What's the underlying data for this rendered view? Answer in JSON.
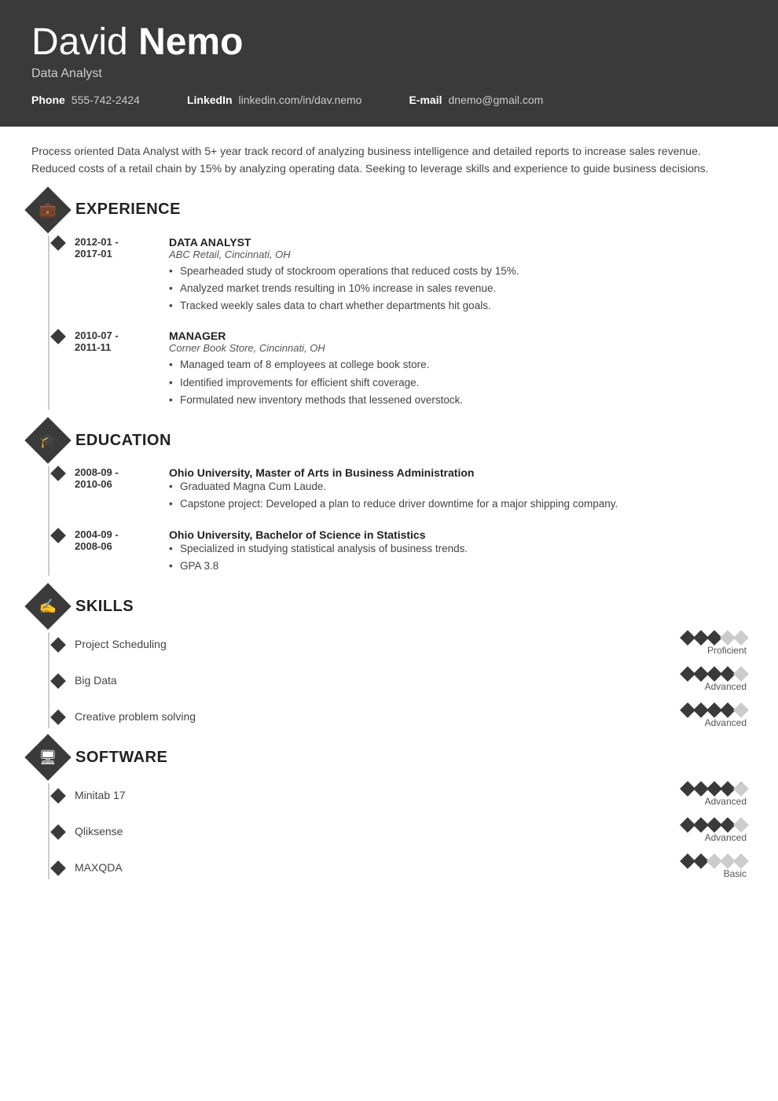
{
  "header": {
    "first_name": "David",
    "last_name": "Nemo",
    "title": "Data Analyst",
    "contacts": [
      {
        "label": "Phone",
        "value": "555-742-2424"
      },
      {
        "label": "LinkedIn",
        "value": "linkedin.com/in/dav.nemo"
      },
      {
        "label": "E-mail",
        "value": "dnemo@gmail.com"
      }
    ]
  },
  "summary": "Process oriented Data Analyst with 5+ year track record of analyzing business intelligence and detailed reports to increase sales revenue. Reduced costs of a retail chain by 15% by analyzing operating data. Seeking to leverage skills and experience to guide business decisions.",
  "sections": {
    "experience": {
      "title": "EXPERIENCE",
      "icon": "briefcase",
      "entries": [
        {
          "date_start": "2012-01 -",
          "date_end": "2017-01",
          "title": "DATA ANALYST",
          "subtitle": "ABC Retail, Cincinnati, OH",
          "bullets": [
            "Spearheaded study of stockroom operations that reduced costs by 15%.",
            "Analyzed market trends resulting in 10% increase in sales revenue.",
            "Tracked weekly sales data to chart whether departments hit goals."
          ]
        },
        {
          "date_start": "2010-07 -",
          "date_end": "2011-11",
          "title": "MANAGER",
          "subtitle": "Corner Book Store, Cincinnati, OH",
          "bullets": [
            "Managed team of 8 employees at college book store.",
            "Identified improvements for efficient shift coverage.",
            "Formulated new inventory methods that lessened overstock."
          ]
        }
      ]
    },
    "education": {
      "title": "EDUCATION",
      "icon": "graduation-cap",
      "entries": [
        {
          "date_start": "2008-09 -",
          "date_end": "2010-06",
          "title": "Ohio University, Master of Arts in Business Administration",
          "subtitle": "",
          "bullets": [
            "Graduated Magna Cum Laude.",
            "Capstone project: Developed a plan to reduce driver downtime for a major shipping company."
          ]
        },
        {
          "date_start": "2004-09 -",
          "date_end": "2008-06",
          "title": "Ohio University, Bachelor of Science in Statistics",
          "subtitle": "",
          "bullets": [
            "Specialized in studying statistical analysis of business trends.",
            "GPA 3.8"
          ]
        }
      ]
    },
    "skills": {
      "title": "SKILLS",
      "icon": "hand",
      "entries": [
        {
          "name": "Project Scheduling",
          "filled": 3,
          "total": 5,
          "level": "Proficient"
        },
        {
          "name": "Big Data",
          "filled": 4,
          "total": 5,
          "level": "Advanced"
        },
        {
          "name": "Creative problem solving",
          "filled": 4,
          "total": 5,
          "level": "Advanced"
        }
      ]
    },
    "software": {
      "title": "SOFTWARE",
      "icon": "monitor",
      "entries": [
        {
          "name": "Minitab 17",
          "filled": 4,
          "total": 5,
          "level": "Advanced"
        },
        {
          "name": "Qliksense",
          "filled": 4,
          "total": 5,
          "level": "Advanced"
        },
        {
          "name": "MAXQDA",
          "filled": 2,
          "total": 5,
          "level": "Basic"
        }
      ]
    }
  }
}
